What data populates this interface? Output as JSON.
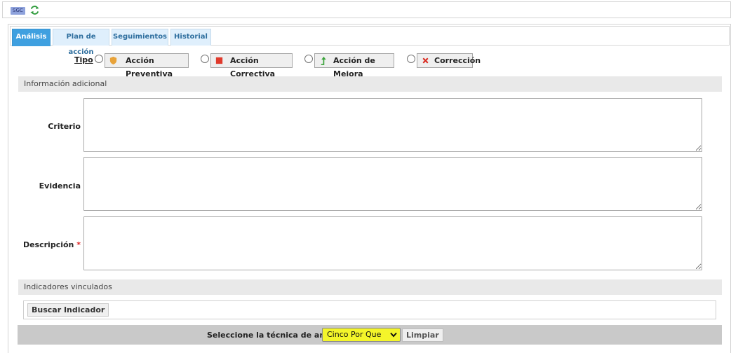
{
  "header": {
    "badge": "SGC",
    "refresh_icon": "refresh-icon"
  },
  "tabs": [
    {
      "label": "Análisis",
      "active": true
    },
    {
      "label": "Plan de acción",
      "active": false
    },
    {
      "label": "Seguimientos",
      "active": false
    },
    {
      "label": "Historial",
      "active": false
    }
  ],
  "tipo": {
    "label_underlined": "Tipo",
    "options": [
      {
        "label": "Acción Preventiva",
        "icon": "shield-icon",
        "color": "#e8a33a"
      },
      {
        "label": "Acción Correctiva",
        "icon": "red-square-icon",
        "color": "#e03a2c"
      },
      {
        "label": "Acción de Mejora",
        "icon": "arrow-up-icon",
        "color": "#3aa33a"
      },
      {
        "label": "Corrección",
        "icon": "close-icon",
        "color": "#d9261c"
      }
    ]
  },
  "info_adicional": {
    "title": "Información adicional",
    "fields": [
      {
        "label": "Criterio",
        "required": false
      },
      {
        "label": "Evidencia",
        "required": false
      },
      {
        "label": "Descripción",
        "required": true,
        "required_mark": "*"
      }
    ]
  },
  "indicadores": {
    "title": "Indicadores vinculados",
    "search_button": "Buscar Indicador"
  },
  "tecnica": {
    "label": "Seleccione la técnica de análisis",
    "selected": "Cinco Por Que",
    "clear_button": "Limpiar",
    "highlight_color": "#f4f52a"
  }
}
